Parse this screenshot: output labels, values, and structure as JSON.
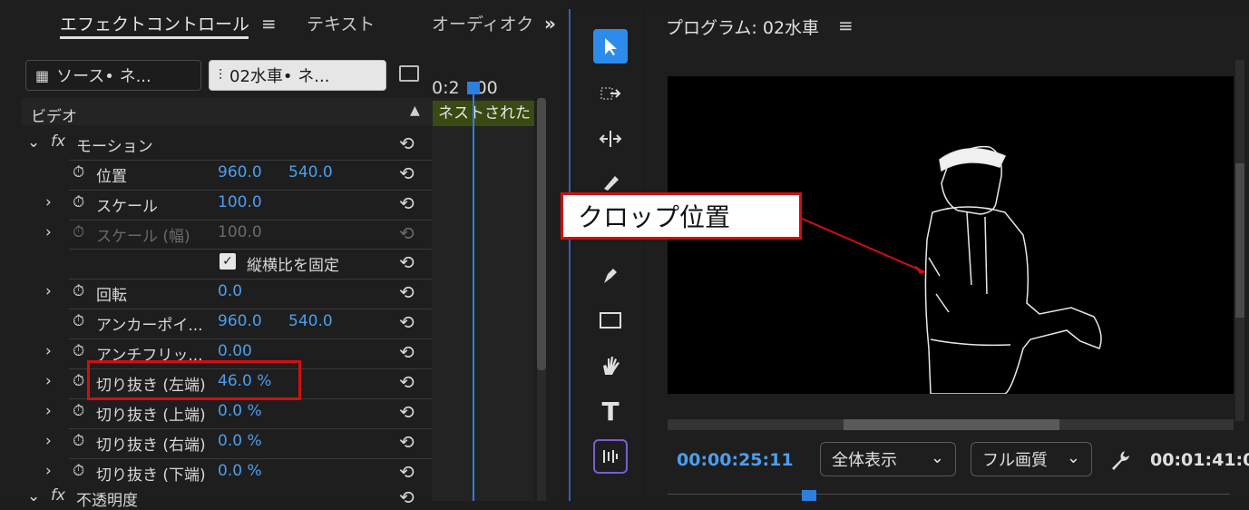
{
  "left_panel": {
    "tabs": [
      "エフェクトコントロール",
      "テキスト",
      "オーディオク"
    ],
    "menu_icon": "hamburger-icon",
    "more_icon": "double-chevron-right-icon",
    "source_button": "ソース• ネ...",
    "sequence_button": "02水車• ネ...",
    "timecode": "0:2",
    "timecode2": "00",
    "section_video": "ビデオ",
    "nest_clip_label": "ネストされた",
    "effect_motion": "モーション",
    "effect_opacity": "不透明度",
    "rows": [
      {
        "label": "位置",
        "v1": "960.0",
        "v2": "540.0"
      },
      {
        "label": "スケール",
        "v1": "100.0"
      },
      {
        "label": "スケール (幅)",
        "v1": "100.0"
      },
      {
        "checkbox": "縦横比を固定"
      },
      {
        "label": "回転",
        "v1": "0.0"
      },
      {
        "label": "アンカーポイ...",
        "v1": "960.0",
        "v2": "540.0"
      },
      {
        "label": "アンチフリッ...",
        "v1": "0.00"
      },
      {
        "label": "切り抜き (左端)",
        "v1": "46.0 %"
      },
      {
        "label": "切り抜き (上端)",
        "v1": "0.0 %"
      },
      {
        "label": "切り抜き (右端)",
        "v1": "0.0 %"
      },
      {
        "label": "切り抜き (下端)",
        "v1": "0.0 %"
      }
    ]
  },
  "program_panel": {
    "title": "プログラム: 02水車",
    "timecode_current": "00:00:25:11",
    "zoom_select": "全体表示",
    "quality_select": "フル画質",
    "timecode_duration": "00:01:41:0"
  },
  "annotation": {
    "callout_text": "クロップ位置"
  },
  "colors": {
    "accent_blue": "#4a9ff0",
    "highlight_red": "#d01010",
    "nest_bar": "#3b4a13"
  }
}
